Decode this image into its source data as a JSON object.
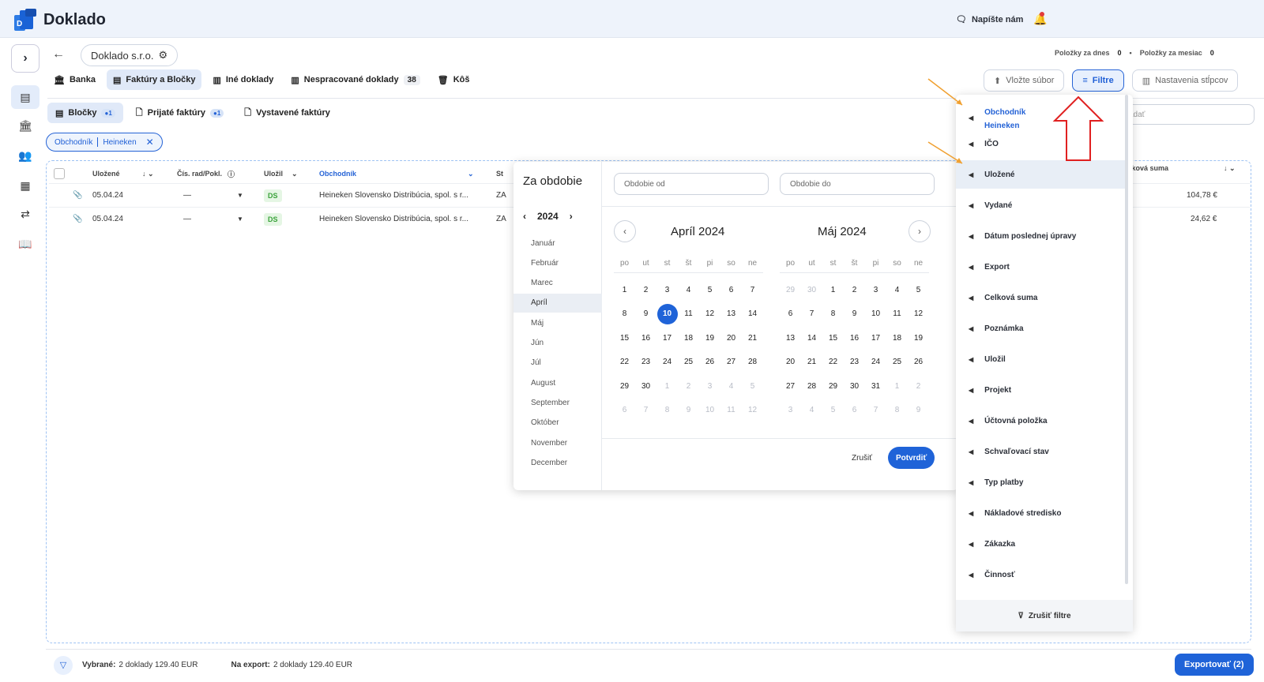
{
  "app": {
    "brand": "Doklado",
    "logo_letter": "D",
    "write_us": "Napíšte nám"
  },
  "company": "Doklado s.r.o.",
  "stats": {
    "today_label": "Položky za dnes",
    "today_val": "0",
    "month_label": "Položky za mesiac",
    "month_val": "0"
  },
  "tabs1": [
    {
      "label": "Banka"
    },
    {
      "label": "Faktúry a Bločky"
    },
    {
      "label": "Iné doklady"
    },
    {
      "label": "Nespracované doklady",
      "badge": "38"
    },
    {
      "label": "Kôš"
    }
  ],
  "right_buttons": {
    "upload": "Vložte súbor",
    "filter": "Filtre",
    "columns": "Nastavenia stĺpcov"
  },
  "tabs2": [
    {
      "label": "Bločky",
      "dot": "●1"
    },
    {
      "label": "Prijaté faktúry",
      "dot": "●1"
    },
    {
      "label": "Vystavené faktúry"
    }
  ],
  "chip": {
    "field": "Obchodník",
    "value": "Heineken"
  },
  "table": {
    "headers": {
      "ulozene": "Uložené",
      "cis": "Čís. rad/Pokl.",
      "ulozil": "Uložil",
      "obchodnik": "Obchodník",
      "st": "St",
      "suma": "lková suma"
    },
    "rows": [
      {
        "date": "05.04.24",
        "cis": "—",
        "ulozil": "DS",
        "obchodnik": "Heineken Slovensko Distribúcia, spol. s r...",
        "st": "ZA",
        "suma": "104,78 €"
      },
      {
        "date": "05.04.24",
        "cis": "—",
        "ulozil": "DS",
        "obchodnik": "Heineken Slovensko Distribúcia, spol. s r...",
        "st": "ZA",
        "suma": "24,62 €"
      }
    ]
  },
  "footer": {
    "selected_label": "Vybrané:",
    "selected_val": "2 doklady 129.40 EUR",
    "export_label": "Na export:",
    "export_val": "2 doklady 129.40 EUR",
    "export_btn": "Exportovať (2)"
  },
  "picker": {
    "title": "Za obdobie",
    "year": "2024",
    "months": [
      "Január",
      "Február",
      "Marec",
      "Apríl",
      "Máj",
      "Jún",
      "Júl",
      "August",
      "September",
      "Október",
      "November",
      "December"
    ],
    "active_month": "Apríl",
    "from_placeholder": "Obdobie od",
    "to_placeholder": "Obdobie do",
    "weekdays": [
      "po",
      "ut",
      "st",
      "št",
      "pi",
      "so",
      "ne"
    ],
    "cal1": {
      "title": "Apríl 2024",
      "selected": "10"
    },
    "cal2": {
      "title": "Máj 2024"
    },
    "cancel": "Zrušiť",
    "confirm": "Potvrdiť"
  },
  "filters": {
    "items": [
      "Obchodník",
      "IČO",
      "Uložené",
      "Vydané",
      "Dátum poslednej úpravy",
      "Export",
      "Celková suma",
      "Poznámka",
      "Uložil",
      "Projekt",
      "Účtovná položka",
      "Schvaľovací stav",
      "Typ platby",
      "Nákladové stredisko",
      "Zákazka",
      "Činnosť"
    ],
    "obchodnik_value": "Heineken",
    "clear": "Zrušiť filtre"
  },
  "search_placeholder": "adať"
}
